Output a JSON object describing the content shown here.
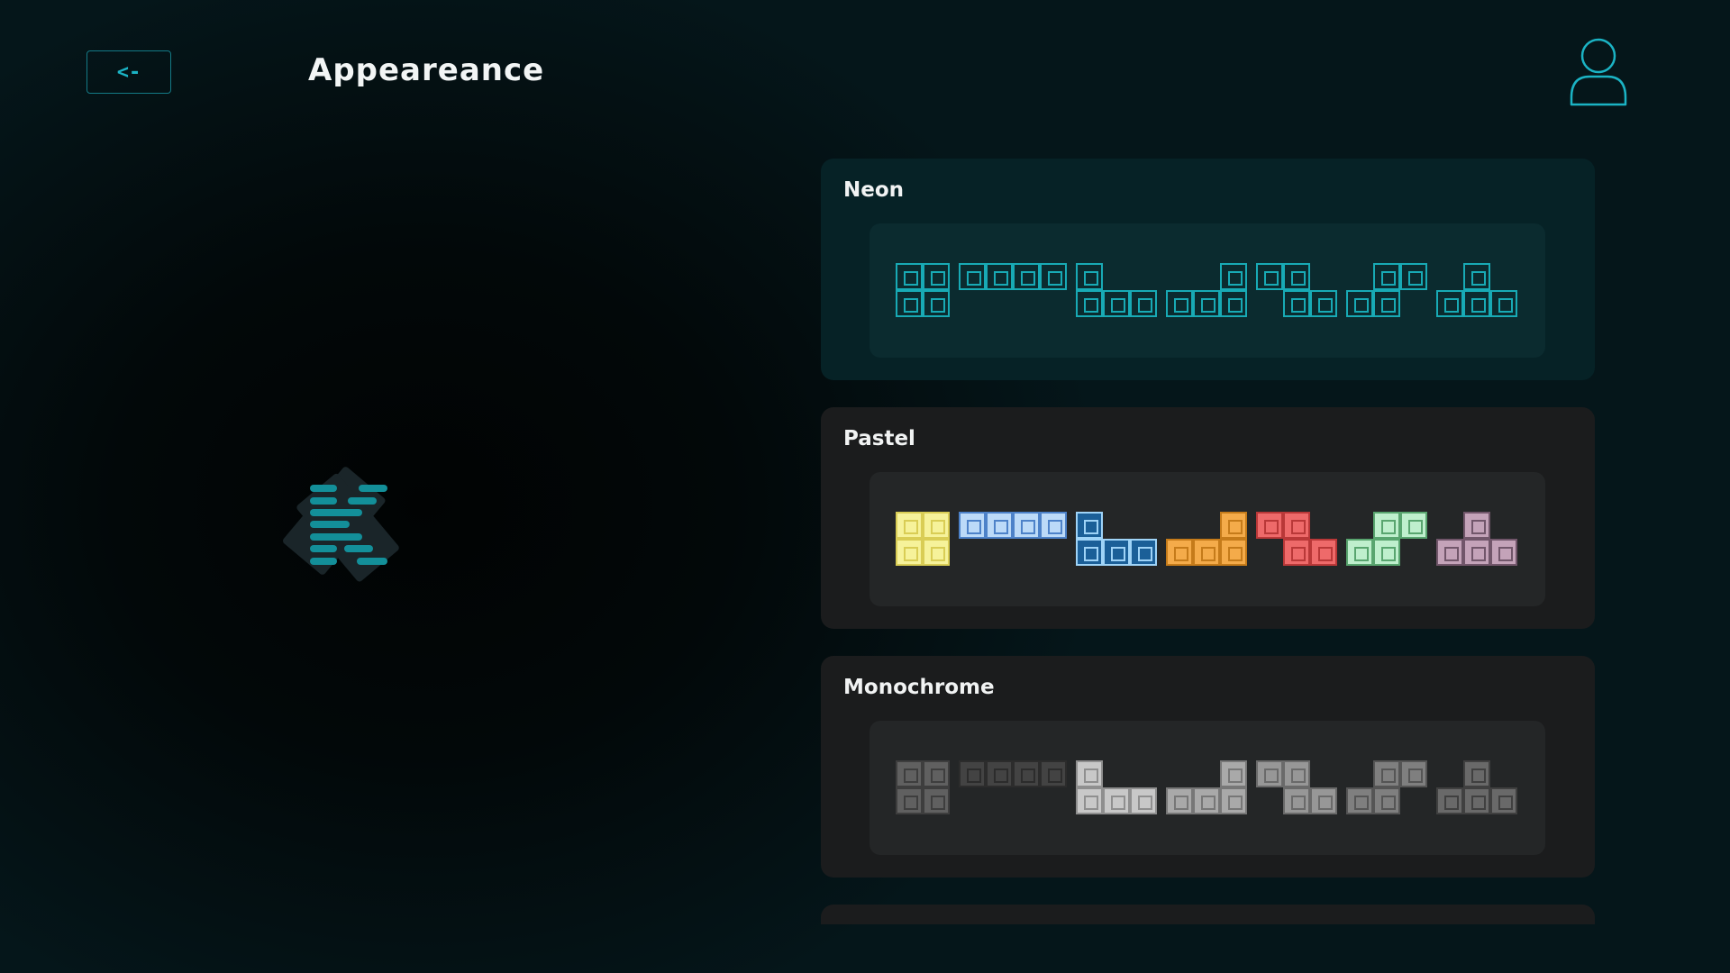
{
  "header": {
    "back_label": "<-",
    "title": "Appeareance"
  },
  "colors": {
    "accent": "#1bb3c4",
    "background": "#05161a",
    "card": "#1b1c1d",
    "card_selected": "#062226"
  },
  "icons": {
    "user": "user-icon",
    "logo": "tetris-logo"
  },
  "themes": [
    {
      "name": "Neon",
      "selected": true,
      "pieces": [
        {
          "cells": [
            [
              1,
              1
            ],
            [
              1,
              1
            ]
          ],
          "border": "#18aab5",
          "fill": "transparent"
        },
        {
          "cells": [
            [
              1,
              1,
              1,
              1
            ]
          ],
          "border": "#18aab5",
          "fill": "transparent"
        },
        {
          "cells": [
            [
              1,
              0,
              0
            ],
            [
              1,
              1,
              1
            ]
          ],
          "border": "#18aab5",
          "fill": "transparent"
        },
        {
          "cells": [
            [
              0,
              0,
              1
            ],
            [
              1,
              1,
              1
            ]
          ],
          "border": "#18aab5",
          "fill": "transparent"
        },
        {
          "cells": [
            [
              1,
              1,
              0
            ],
            [
              0,
              1,
              1
            ]
          ],
          "border": "#18aab5",
          "fill": "transparent"
        },
        {
          "cells": [
            [
              0,
              1,
              1
            ],
            [
              1,
              1,
              0
            ]
          ],
          "border": "#18aab5",
          "fill": "transparent"
        },
        {
          "cells": [
            [
              0,
              1,
              0
            ],
            [
              1,
              1,
              1
            ]
          ],
          "border": "#18aab5",
          "fill": "transparent"
        }
      ]
    },
    {
      "name": "Pastel",
      "selected": false,
      "pieces": [
        {
          "cells": [
            [
              1,
              1
            ],
            [
              1,
              1
            ]
          ],
          "border": "#d9cd55",
          "fill": "#f6f29a"
        },
        {
          "cells": [
            [
              1,
              1,
              1,
              1
            ]
          ],
          "border": "#4d82c9",
          "fill": "#bcdaf8"
        },
        {
          "cells": [
            [
              1,
              0,
              0
            ],
            [
              1,
              1,
              1
            ]
          ],
          "border": "#9fd3f7",
          "fill": "#1b5f98"
        },
        {
          "cells": [
            [
              0,
              0,
              1
            ],
            [
              1,
              1,
              1
            ]
          ],
          "border": "#c57b1a",
          "fill": "#f4ab4a"
        },
        {
          "cells": [
            [
              1,
              1,
              0
            ],
            [
              0,
              1,
              1
            ]
          ],
          "border": "#b93838",
          "fill": "#ee6a6a"
        },
        {
          "cells": [
            [
              0,
              1,
              1
            ],
            [
              1,
              1,
              0
            ]
          ],
          "border": "#59a56f",
          "fill": "#bfefcd"
        },
        {
          "cells": [
            [
              0,
              1,
              0
            ],
            [
              1,
              1,
              1
            ]
          ],
          "border": "#71566a",
          "fill": "#c4a3b9"
        }
      ]
    },
    {
      "name": "Monochrome",
      "selected": false,
      "pieces": [
        {
          "cells": [
            [
              1,
              1
            ],
            [
              1,
              1
            ]
          ],
          "border": "#3e3e3e",
          "fill": "#606060"
        },
        {
          "cells": [
            [
              1,
              1,
              1,
              1
            ]
          ],
          "border": "#2c2c2c",
          "fill": "#434343"
        },
        {
          "cells": [
            [
              1,
              0,
              0
            ],
            [
              1,
              1,
              1
            ]
          ],
          "border": "#8f8f8f",
          "fill": "#c8c8c8"
        },
        {
          "cells": [
            [
              0,
              0,
              1
            ],
            [
              1,
              1,
              1
            ]
          ],
          "border": "#777777",
          "fill": "#a9a9a9"
        },
        {
          "cells": [
            [
              1,
              1,
              0
            ],
            [
              0,
              1,
              1
            ]
          ],
          "border": "#6a6a6a",
          "fill": "#979797"
        },
        {
          "cells": [
            [
              0,
              1,
              1
            ],
            [
              1,
              1,
              0
            ]
          ],
          "border": "#555555",
          "fill": "#7f7f7f"
        },
        {
          "cells": [
            [
              0,
              1,
              0
            ],
            [
              1,
              1,
              1
            ]
          ],
          "border": "#404040",
          "fill": "#696969"
        }
      ]
    }
  ]
}
